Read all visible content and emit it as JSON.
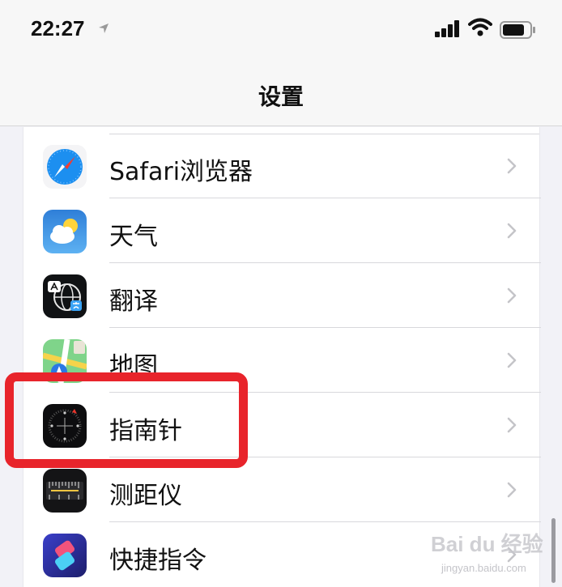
{
  "status_bar": {
    "time": "22:27",
    "location_icon": "location-arrow-icon",
    "signal_icon": "cellular-signal-icon",
    "wifi_icon": "wifi-icon",
    "battery_icon": "battery-icon"
  },
  "nav": {
    "title": "设置"
  },
  "settings_list": [
    {
      "label": "Safari浏览器",
      "icon": "safari-icon"
    },
    {
      "label": "天气",
      "icon": "weather-icon"
    },
    {
      "label": "翻译",
      "icon": "translate-icon"
    },
    {
      "label": "地图",
      "icon": "maps-icon"
    },
    {
      "label": "指南针",
      "icon": "compass-icon"
    },
    {
      "label": "测距仪",
      "icon": "measure-icon"
    },
    {
      "label": "快捷指令",
      "icon": "shortcuts-icon"
    }
  ],
  "annotation": {
    "highlighted_item": "指南针",
    "highlight_color": "#e8242b"
  },
  "watermark": {
    "brand": "Bai du 经验",
    "site": "jingyan.baidu.com"
  }
}
